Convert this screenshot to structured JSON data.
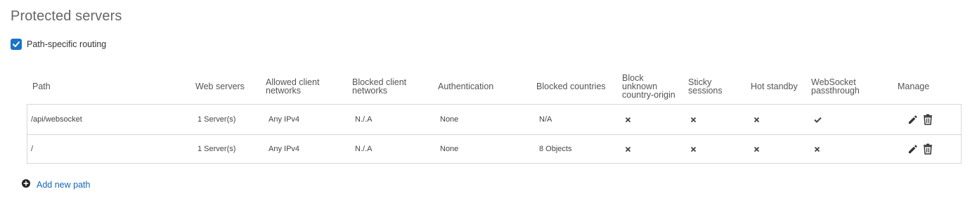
{
  "section": {
    "title": "Protected servers"
  },
  "routing": {
    "checkbox_label": "Path-specific routing",
    "checked": true
  },
  "table": {
    "columns": {
      "path": "Path",
      "web_servers": "Web servers",
      "allowed_l1": "Allowed client",
      "allowed_l2": "networks",
      "blocked_l1": "Blocked client",
      "blocked_l2": "networks",
      "auth": "Authentication",
      "countries": "Blocked countries",
      "block_l1": "Block",
      "block_l2": "unknown",
      "block_l3": "country-origin",
      "sticky_l1": "Sticky",
      "sticky_l2": "sessions",
      "hot": "Hot standby",
      "ws_l1": "WebSocket",
      "ws_l2": "passthrough",
      "manage": "Manage"
    },
    "rows": [
      {
        "path": "/api/websocket",
        "web_servers": "1 Server(s)",
        "allowed": "Any IPv4",
        "blocked": "N./.A",
        "auth": "None",
        "countries": "N/A",
        "block_unknown": "x-icon",
        "sticky": "x-icon",
        "hot_standby": "x-icon",
        "websocket": "check-icon"
      },
      {
        "path": "/",
        "web_servers": "1 Server(s)",
        "allowed": "Any IPv4",
        "blocked": "N./.A",
        "auth": "None",
        "countries": "8 Objects",
        "block_unknown": "x-icon",
        "sticky": "x-icon",
        "hot_standby": "x-icon",
        "websocket": "x-icon"
      }
    ]
  },
  "actions": {
    "add_label": "Add new path"
  },
  "colors": {
    "accent": "#1a73c6",
    "link": "#1565b8",
    "border": "#d8d8d8"
  }
}
